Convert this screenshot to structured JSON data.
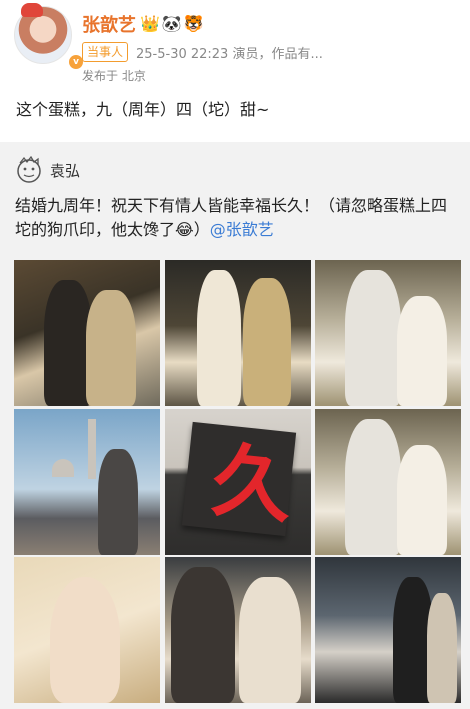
{
  "post": {
    "author_name": "张歆艺",
    "author_emojis": "👑🐼🐯",
    "verified_badge": "v",
    "tag": "当事人",
    "timestamp": "25-5-30 22:23",
    "source": "演员，作品有...",
    "location": "发布于 北京",
    "text": "这个蛋糕，九（周年）四（坨）甜~"
  },
  "repost": {
    "author_name": "袁弘",
    "text": "结婚九周年！祝天下有情人皆能幸福长久！（请忽略蛋糕上四坨的狗爪印，他太馋了😂）",
    "mention": "@张歆艺",
    "cake_character": "久"
  },
  "colors": {
    "author_name": "#e8742c",
    "tag": "#f39c2e",
    "mention": "#3b7cd4",
    "repost_bg": "#f2f2f2"
  }
}
